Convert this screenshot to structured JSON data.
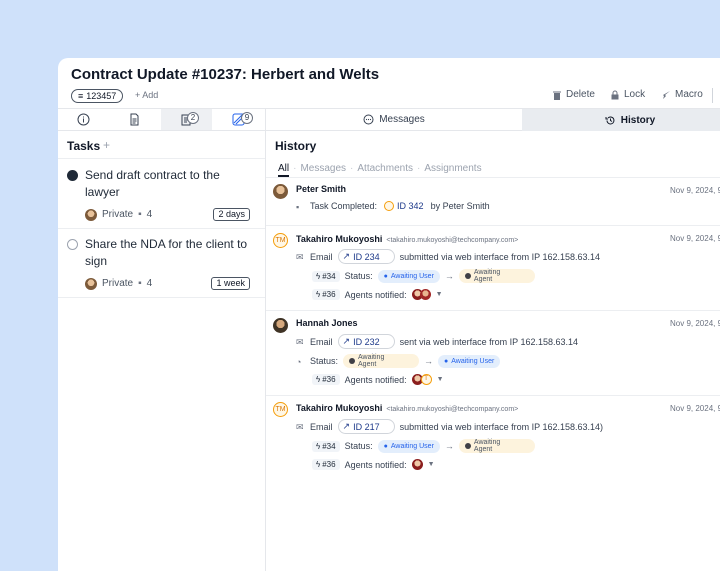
{
  "header": {
    "title": "Contract Update #10237: Herbert and Welts",
    "tag": "123457",
    "add_label": "+ Add",
    "actions": {
      "delete": "Delete",
      "lock": "Lock",
      "macro": "Macro"
    }
  },
  "left_tabs": {
    "tasks_badge": "2",
    "linked_badge": "9"
  },
  "tasks": {
    "heading": "Tasks",
    "plus": "+",
    "items": [
      {
        "text": "Send draft contract to the lawyer",
        "done": true,
        "visibility": "Private",
        "comments": "4",
        "due": "2 days"
      },
      {
        "text": "Share the NDA for the client to sign",
        "done": false,
        "visibility": "Private",
        "comments": "4",
        "due": "1 week"
      }
    ]
  },
  "right_tabs": {
    "messages": "Messages",
    "history": "History"
  },
  "history": {
    "heading": "History",
    "filters": [
      "All",
      "Messages",
      "Attachments",
      "Assignments"
    ],
    "entries": [
      {
        "author": "Peter Smith",
        "timestamp": "Nov 9, 2024, 9:",
        "line1": {
          "label": "Task Completed:",
          "id": "ID 342",
          "suffix": "by Peter Smith"
        }
      },
      {
        "author": "Takahiro Mukoyoshi",
        "email": "<takahiro.mukoyoshi@techcompany.com>",
        "avatar": "TM",
        "timestamp": "Nov 9, 2024, 9:",
        "line1": {
          "label": "Email",
          "id": "ID 234",
          "suffix": "submitted via web interface from IP 162.158.63.14"
        },
        "line2": {
          "ref": "#34",
          "label": "Status:",
          "from": "Awaiting User",
          "to_line1": "Awaiting",
          "to_line2": "Agent"
        },
        "line3": {
          "ref": "#36",
          "label": "Agents notified:"
        }
      },
      {
        "author": "Hannah Jones",
        "timestamp": "Nov 9, 2024, 9:",
        "line1": {
          "label": "Email",
          "id": "ID 232",
          "suffix": "sent via web interface from IP 162.158.63.14"
        },
        "line2": {
          "label": "Status:",
          "from_line1": "Awaiting",
          "from_line2": "Agent",
          "to": "Awaiting User"
        },
        "line3": {
          "ref": "#36",
          "label": "Agents notified:"
        }
      },
      {
        "author": "Takahiro Mukoyoshi",
        "email": "<takahiro.mukoyoshi@techcompany.com>",
        "avatar": "TM",
        "timestamp": "Nov 9, 2024, 9:",
        "line1": {
          "label": "Email",
          "id": "ID 217",
          "suffix": "submitted via web interface from IP 162.158.63.14)"
        },
        "line2": {
          "ref": "#34",
          "label": "Status:",
          "from": "Awaiting User",
          "to_line1": "Awaiting",
          "to_line2": "Agent"
        },
        "line3": {
          "ref": "#36",
          "label": "Agents notified:"
        }
      }
    ]
  },
  "colors": {
    "accent_blue": "#2563eb",
    "awaiting_agent_bg": "#fdf3dd",
    "awaiting_user_bg": "#e3eefc",
    "tm_orange": "#f59e0b"
  }
}
